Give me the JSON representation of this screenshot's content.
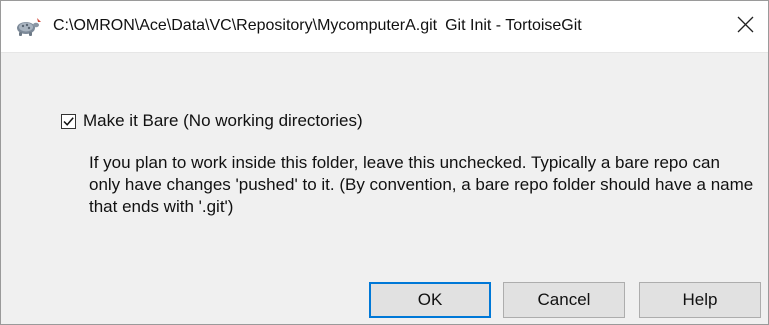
{
  "window": {
    "path": "C:\\OMRON\\Ace\\Data\\VC\\Repository\\MycomputerA.git",
    "title": "Git Init - TortoiseGit",
    "app_icon": "tortoise-icon",
    "close_icon": "close-icon"
  },
  "option": {
    "checked": true,
    "label": "Make it Bare (No working directories)",
    "description": "If you plan to work inside this folder, leave this unchecked. Typically a bare repo can only have changes 'pushed' to it. (By convention, a bare repo folder should have a name that ends with '.git')"
  },
  "buttons": {
    "ok": "OK",
    "cancel": "Cancel",
    "help": "Help"
  },
  "colors": {
    "accent": "#0078d7",
    "dialog_bg": "#f0f0f0",
    "button_bg": "#e1e1e1"
  }
}
